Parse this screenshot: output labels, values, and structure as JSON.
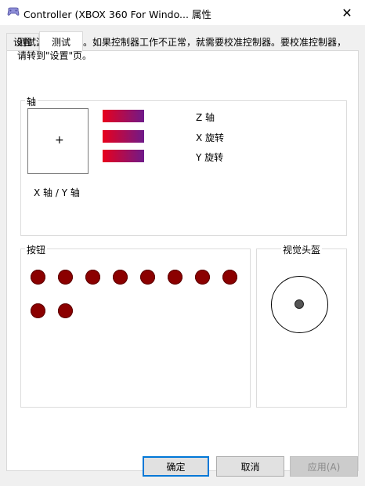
{
  "window": {
    "title": "Controller (XBOX 360 For Windo... 属性",
    "close_glyph": "✕"
  },
  "tabs": [
    {
      "label": "设置"
    },
    {
      "label": "测试"
    }
  ],
  "description": "测试游戏控制器。如果控制器工作不正常，就需要校准控制器。要校准控制器，请转到\"设置\"页。",
  "axes_group": {
    "label": "轴",
    "xy_label": "X 轴 / Y 轴",
    "crosshair": "+",
    "bars": [
      {
        "label": "Z 轴"
      },
      {
        "label": "X 旋转"
      },
      {
        "label": "Y 旋转"
      }
    ]
  },
  "buttons_group": {
    "label": "按钮",
    "button_count": 10
  },
  "pov_group": {
    "label": "视觉头盔"
  },
  "footer": {
    "ok_label": "确定",
    "cancel_label": "取消",
    "apply_label": "应用(A)"
  },
  "colors": {
    "bar_start": "#e8001c",
    "bar_end": "#6f1a8a",
    "button_dot": "#8b0000",
    "focus_border": "#0078d7"
  }
}
